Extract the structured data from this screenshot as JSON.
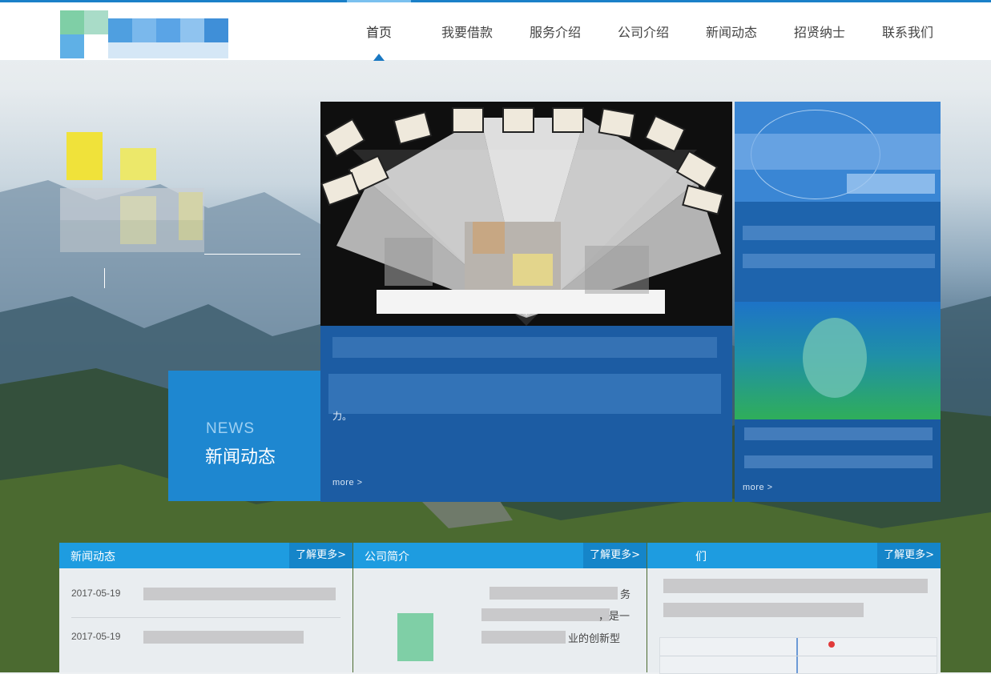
{
  "nav": {
    "items": [
      "首页",
      "我要借款",
      "服务介绍",
      "公司介绍",
      "新闻动态",
      "招贤纳士",
      "联系我们"
    ]
  },
  "hero": {
    "news_en": "NEWS",
    "news_cn": "新闻动态",
    "feature_more": "more >",
    "feature_text_fragment": "力。",
    "side_more": "more >"
  },
  "panels": [
    {
      "title": "新闻动态",
      "more": "了解更多>",
      "dates": [
        "2017-05-19",
        "2017-05-19"
      ]
    },
    {
      "title": "公司简介",
      "more": "了解更多>",
      "text_fragments": [
        "务",
        "，是一",
        "业的创新型"
      ]
    },
    {
      "title": "们",
      "more": "了解更多>"
    }
  ],
  "colors": {
    "accent": "#1e87d0",
    "panel_header": "#1e9ce0",
    "feature_bg": "#1c5ca3"
  }
}
